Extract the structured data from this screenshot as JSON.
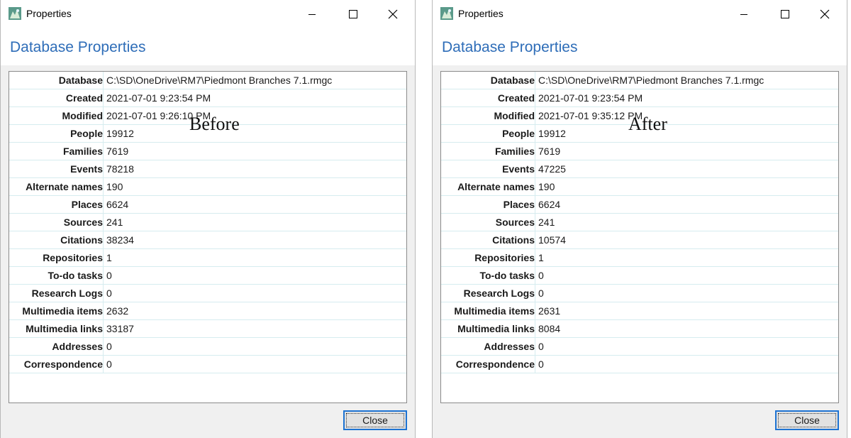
{
  "windows": [
    {
      "title": "Properties",
      "heading": "Database Properties",
      "overlay_label": "Before",
      "close_label": "Close",
      "rows": [
        {
          "label": "Database",
          "value": "C:\\SD\\OneDrive\\RM7\\Piedmont Branches 7.1.rmgc"
        },
        {
          "label": "Created",
          "value": "2021-07-01 9:23:54 PM"
        },
        {
          "label": "Modified",
          "value": "2021-07-01 9:26:10 PM"
        },
        {
          "label": "People",
          "value": "19912"
        },
        {
          "label": "Families",
          "value": "7619"
        },
        {
          "label": "Events",
          "value": "78218"
        },
        {
          "label": "Alternate names",
          "value": "190"
        },
        {
          "label": "Places",
          "value": "6624"
        },
        {
          "label": "Sources",
          "value": "241"
        },
        {
          "label": "Citations",
          "value": "38234"
        },
        {
          "label": "Repositories",
          "value": "1"
        },
        {
          "label": "To-do tasks",
          "value": "0"
        },
        {
          "label": "Research Logs",
          "value": "0"
        },
        {
          "label": "Multimedia items",
          "value": "2632"
        },
        {
          "label": "Multimedia links",
          "value": "33187"
        },
        {
          "label": "Addresses",
          "value": "0"
        },
        {
          "label": "Correspondence",
          "value": "0"
        }
      ]
    },
    {
      "title": "Properties",
      "heading": "Database Properties",
      "overlay_label": "After",
      "close_label": "Close",
      "rows": [
        {
          "label": "Database",
          "value": "C:\\SD\\OneDrive\\RM7\\Piedmont Branches 7.1.rmgc"
        },
        {
          "label": "Created",
          "value": "2021-07-01 9:23:54 PM"
        },
        {
          "label": "Modified",
          "value": "2021-07-01 9:35:12 PM"
        },
        {
          "label": "People",
          "value": "19912"
        },
        {
          "label": "Families",
          "value": "7619"
        },
        {
          "label": "Events",
          "value": "47225"
        },
        {
          "label": "Alternate names",
          "value": "190"
        },
        {
          "label": "Places",
          "value": "6624"
        },
        {
          "label": "Sources",
          "value": "241"
        },
        {
          "label": "Citations",
          "value": "10574"
        },
        {
          "label": "Repositories",
          "value": "1"
        },
        {
          "label": "To-do tasks",
          "value": "0"
        },
        {
          "label": "Research Logs",
          "value": "0"
        },
        {
          "label": "Multimedia items",
          "value": "2631"
        },
        {
          "label": "Multimedia links",
          "value": "8084"
        },
        {
          "label": "Addresses",
          "value": "0"
        },
        {
          "label": "Correspondence",
          "value": "0"
        }
      ]
    }
  ]
}
